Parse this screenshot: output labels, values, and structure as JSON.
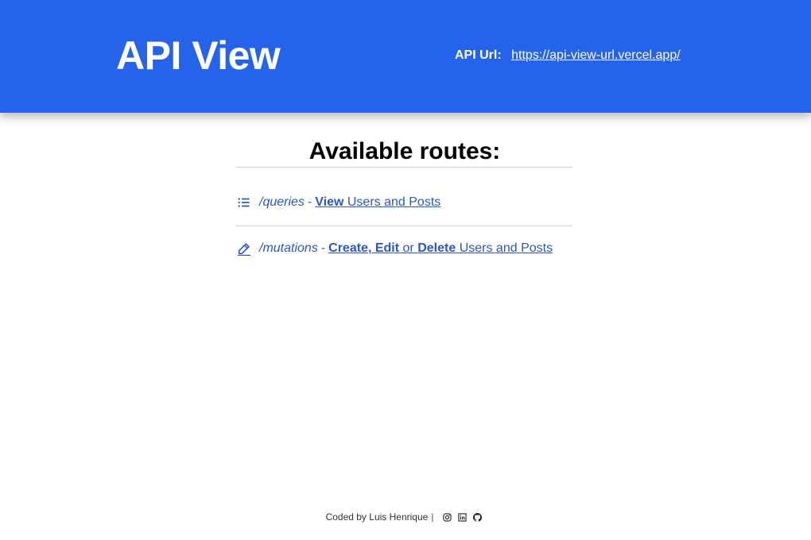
{
  "header": {
    "title": "API View",
    "api_url_label": "API Url:",
    "api_url": "https://api-view-url.vercel.app/"
  },
  "main": {
    "heading": "Available routes:",
    "routes": [
      {
        "icon": "list-icon",
        "path": "/queries",
        "separator": "-",
        "action_bold": "View",
        "action_rest": "Users and Posts"
      },
      {
        "icon": "pencil-icon",
        "path": "/mutations",
        "separator": "-",
        "create": "Create",
        "comma": ",",
        "edit": "Edit",
        "or": "or",
        "delete": "Delete",
        "action_rest": "Users and Posts"
      }
    ]
  },
  "footer": {
    "credit": "Coded by Luis Henrique",
    "divider": "|",
    "social_icons": [
      "instagram-icon",
      "linkedin-icon",
      "github-icon"
    ]
  },
  "colors": {
    "header_bg": "#2563eb",
    "link": "#2d55c8"
  }
}
